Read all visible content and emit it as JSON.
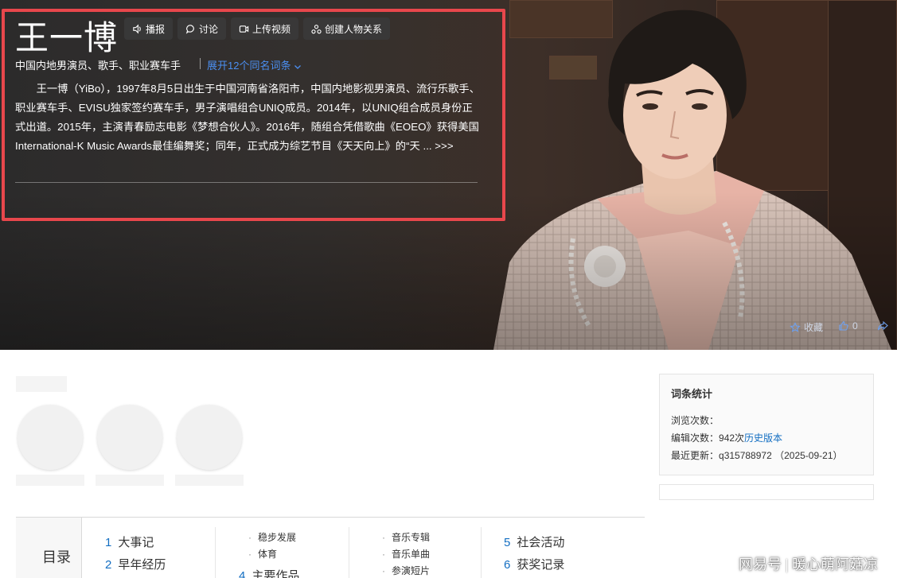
{
  "entry": {
    "title": "王一博",
    "buttons": {
      "broadcast": "播报",
      "discuss": "讨论",
      "upload_video": "上传视频",
      "create_relation": "创建人物关系"
    },
    "subtitle": "中国内地男演员、歌手、职业赛车手",
    "expand_link": "展开12个同名词条",
    "summary": "王一博（YiBo），1997年8月5日出生于中国河南省洛阳市，中国内地影视男演员、流行乐歌手、职业赛车手、EVISU独家签约赛车手，男子演唱组合UNIQ成员。2014年，以UNIQ组合成员身份正式出道。2015年，主演青春励志电影《梦想合伙人》。2016年，随组合凭借歌曲《EOEO》获得美国International-K Music Awards最佳编舞奖；同年，正式成为综艺节目《天天向上》的“天",
    "more_link": "... >>>",
    "actions": {
      "favorite": "收藏",
      "like_count": "0"
    }
  },
  "stats": {
    "title": "词条统计",
    "views_label": "浏览次数：",
    "edits_label": "编辑次数：",
    "edits_value": "942次",
    "history_link": "历史版本",
    "updated_label": "最近更新：",
    "updated_user": "q315788972",
    "updated_date": "（2025-09-21）"
  },
  "toc": {
    "label": "目录",
    "items": [
      {
        "num": "1",
        "label": "大事记"
      },
      {
        "num": "2",
        "label": "早年经历"
      },
      {
        "num": "4",
        "label": "主要作品"
      },
      {
        "num": "5",
        "label": "社会活动"
      },
      {
        "num": "6",
        "label": "获奖记录"
      }
    ],
    "sub_col1": [
      "稳步发展",
      "体育"
    ],
    "sub_col2": [
      "音乐专辑",
      "音乐单曲",
      "参演短片"
    ]
  },
  "watermark": {
    "brand": "网易号",
    "author": "暖心萌阿菇凉"
  },
  "colors": {
    "highlight_border": "#e8474c",
    "link_blue": "#136ec2",
    "expand_blue": "#4b8ff1"
  }
}
